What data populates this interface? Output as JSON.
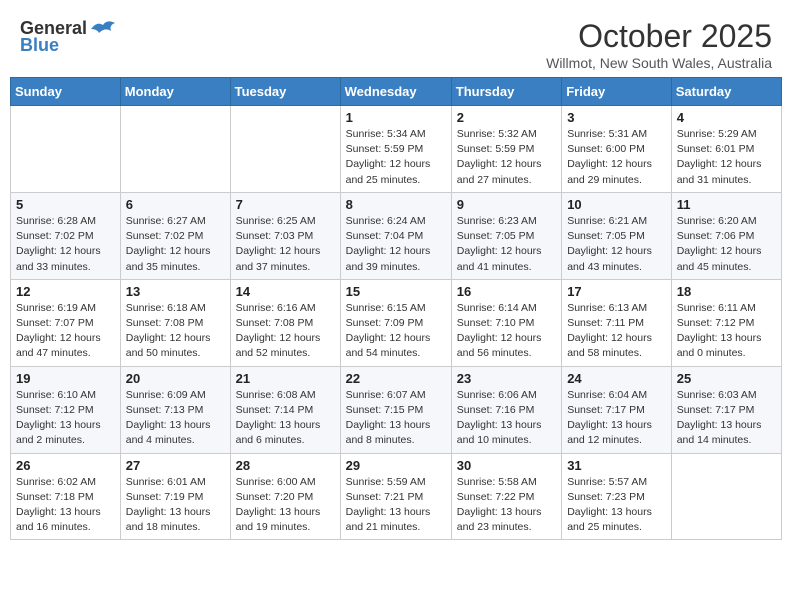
{
  "header": {
    "logo_general": "General",
    "logo_blue": "Blue",
    "month": "October 2025",
    "location": "Willmot, New South Wales, Australia"
  },
  "days_of_week": [
    "Sunday",
    "Monday",
    "Tuesday",
    "Wednesday",
    "Thursday",
    "Friday",
    "Saturday"
  ],
  "weeks": [
    [
      {
        "day": "",
        "info": ""
      },
      {
        "day": "",
        "info": ""
      },
      {
        "day": "",
        "info": ""
      },
      {
        "day": "1",
        "info": "Sunrise: 5:34 AM\nSunset: 5:59 PM\nDaylight: 12 hours\nand 25 minutes."
      },
      {
        "day": "2",
        "info": "Sunrise: 5:32 AM\nSunset: 5:59 PM\nDaylight: 12 hours\nand 27 minutes."
      },
      {
        "day": "3",
        "info": "Sunrise: 5:31 AM\nSunset: 6:00 PM\nDaylight: 12 hours\nand 29 minutes."
      },
      {
        "day": "4",
        "info": "Sunrise: 5:29 AM\nSunset: 6:01 PM\nDaylight: 12 hours\nand 31 minutes."
      }
    ],
    [
      {
        "day": "5",
        "info": "Sunrise: 6:28 AM\nSunset: 7:02 PM\nDaylight: 12 hours\nand 33 minutes."
      },
      {
        "day": "6",
        "info": "Sunrise: 6:27 AM\nSunset: 7:02 PM\nDaylight: 12 hours\nand 35 minutes."
      },
      {
        "day": "7",
        "info": "Sunrise: 6:25 AM\nSunset: 7:03 PM\nDaylight: 12 hours\nand 37 minutes."
      },
      {
        "day": "8",
        "info": "Sunrise: 6:24 AM\nSunset: 7:04 PM\nDaylight: 12 hours\nand 39 minutes."
      },
      {
        "day": "9",
        "info": "Sunrise: 6:23 AM\nSunset: 7:05 PM\nDaylight: 12 hours\nand 41 minutes."
      },
      {
        "day": "10",
        "info": "Sunrise: 6:21 AM\nSunset: 7:05 PM\nDaylight: 12 hours\nand 43 minutes."
      },
      {
        "day": "11",
        "info": "Sunrise: 6:20 AM\nSunset: 7:06 PM\nDaylight: 12 hours\nand 45 minutes."
      }
    ],
    [
      {
        "day": "12",
        "info": "Sunrise: 6:19 AM\nSunset: 7:07 PM\nDaylight: 12 hours\nand 47 minutes."
      },
      {
        "day": "13",
        "info": "Sunrise: 6:18 AM\nSunset: 7:08 PM\nDaylight: 12 hours\nand 50 minutes."
      },
      {
        "day": "14",
        "info": "Sunrise: 6:16 AM\nSunset: 7:08 PM\nDaylight: 12 hours\nand 52 minutes."
      },
      {
        "day": "15",
        "info": "Sunrise: 6:15 AM\nSunset: 7:09 PM\nDaylight: 12 hours\nand 54 minutes."
      },
      {
        "day": "16",
        "info": "Sunrise: 6:14 AM\nSunset: 7:10 PM\nDaylight: 12 hours\nand 56 minutes."
      },
      {
        "day": "17",
        "info": "Sunrise: 6:13 AM\nSunset: 7:11 PM\nDaylight: 12 hours\nand 58 minutes."
      },
      {
        "day": "18",
        "info": "Sunrise: 6:11 AM\nSunset: 7:12 PM\nDaylight: 13 hours\nand 0 minutes."
      }
    ],
    [
      {
        "day": "19",
        "info": "Sunrise: 6:10 AM\nSunset: 7:12 PM\nDaylight: 13 hours\nand 2 minutes."
      },
      {
        "day": "20",
        "info": "Sunrise: 6:09 AM\nSunset: 7:13 PM\nDaylight: 13 hours\nand 4 minutes."
      },
      {
        "day": "21",
        "info": "Sunrise: 6:08 AM\nSunset: 7:14 PM\nDaylight: 13 hours\nand 6 minutes."
      },
      {
        "day": "22",
        "info": "Sunrise: 6:07 AM\nSunset: 7:15 PM\nDaylight: 13 hours\nand 8 minutes."
      },
      {
        "day": "23",
        "info": "Sunrise: 6:06 AM\nSunset: 7:16 PM\nDaylight: 13 hours\nand 10 minutes."
      },
      {
        "day": "24",
        "info": "Sunrise: 6:04 AM\nSunset: 7:17 PM\nDaylight: 13 hours\nand 12 minutes."
      },
      {
        "day": "25",
        "info": "Sunrise: 6:03 AM\nSunset: 7:17 PM\nDaylight: 13 hours\nand 14 minutes."
      }
    ],
    [
      {
        "day": "26",
        "info": "Sunrise: 6:02 AM\nSunset: 7:18 PM\nDaylight: 13 hours\nand 16 minutes."
      },
      {
        "day": "27",
        "info": "Sunrise: 6:01 AM\nSunset: 7:19 PM\nDaylight: 13 hours\nand 18 minutes."
      },
      {
        "day": "28",
        "info": "Sunrise: 6:00 AM\nSunset: 7:20 PM\nDaylight: 13 hours\nand 19 minutes."
      },
      {
        "day": "29",
        "info": "Sunrise: 5:59 AM\nSunset: 7:21 PM\nDaylight: 13 hours\nand 21 minutes."
      },
      {
        "day": "30",
        "info": "Sunrise: 5:58 AM\nSunset: 7:22 PM\nDaylight: 13 hours\nand 23 minutes."
      },
      {
        "day": "31",
        "info": "Sunrise: 5:57 AM\nSunset: 7:23 PM\nDaylight: 13 hours\nand 25 minutes."
      },
      {
        "day": "",
        "info": ""
      }
    ]
  ]
}
